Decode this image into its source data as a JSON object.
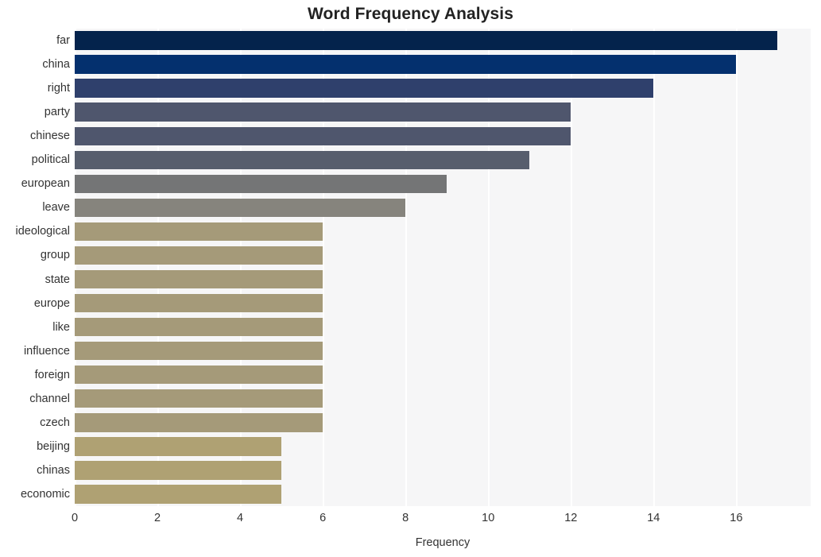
{
  "chart_data": {
    "type": "bar",
    "orientation": "horizontal",
    "title": "Word Frequency Analysis",
    "xlabel": "Frequency",
    "ylabel": "",
    "categories": [
      "far",
      "china",
      "right",
      "party",
      "chinese",
      "political",
      "european",
      "leave",
      "ideological",
      "group",
      "state",
      "europe",
      "like",
      "influence",
      "foreign",
      "channel",
      "czech",
      "beijing",
      "chinas",
      "economic"
    ],
    "values": [
      17,
      16,
      14,
      12,
      12,
      11,
      9,
      8,
      6,
      6,
      6,
      6,
      6,
      6,
      6,
      6,
      6,
      5,
      5,
      5
    ],
    "xticks": [
      0,
      2,
      4,
      6,
      8,
      10,
      12,
      14,
      16
    ],
    "xtick_labels": [
      "0",
      "2",
      "4",
      "6",
      "8",
      "10",
      "12",
      "14",
      "16"
    ],
    "xlim": [
      0,
      17.8
    ],
    "grid": true,
    "legend": false,
    "bar_colors": [
      "#04234c",
      "#04306e",
      "#2f406c",
      "#4f566d",
      "#4f566d",
      "#575e6d",
      "#747576",
      "#86847d",
      "#a59a79",
      "#a59a79",
      "#a59a79",
      "#a59a79",
      "#a59a79",
      "#a59a79",
      "#a59a79",
      "#a59a79",
      "#a59a79",
      "#afa173",
      "#afa173",
      "#afa173"
    ],
    "plot_background": "#f6f6f7",
    "grid_color": "#ffffff",
    "figure_background": "#ffffff",
    "text_color": "#333333",
    "title_color": "#222222"
  }
}
